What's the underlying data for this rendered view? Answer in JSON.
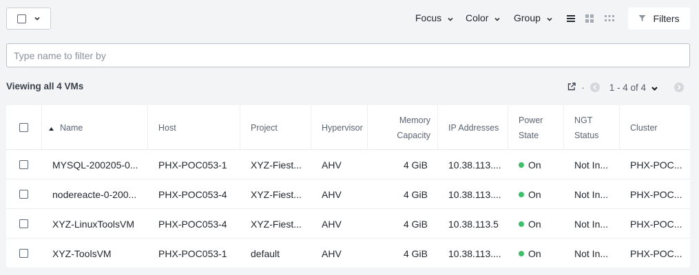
{
  "toolbar": {
    "menus": [
      {
        "label": "Focus",
        "icon": "chevron-down-icon"
      },
      {
        "label": "Color",
        "icon": "chevron-down-icon"
      },
      {
        "label": "Group",
        "icon": "chevron-down-icon"
      }
    ],
    "view_icons": [
      "list-view-icon",
      "grid-view-icon",
      "tile-view-icon"
    ],
    "filters_label": "Filters",
    "filters_icon": "funnel-icon"
  },
  "search": {
    "placeholder": "Type name to filter by",
    "value": ""
  },
  "summary": {
    "text": "Viewing all 4 VMs"
  },
  "pager": {
    "range_label": "1 - 4 of 4",
    "separator": "·"
  },
  "table": {
    "columns": [
      {
        "label": "Name",
        "sort": "ascending"
      },
      {
        "label": "Host"
      },
      {
        "label": "Project"
      },
      {
        "label": "Hypervisor"
      },
      {
        "label_line1": "Memory",
        "label_line2": "Capacity"
      },
      {
        "label": "IP Addresses"
      },
      {
        "label_line1": "Power",
        "label_line2": "State"
      },
      {
        "label_line1": "NGT",
        "label_line2": "Status"
      },
      {
        "label": "Cluster"
      }
    ],
    "rows": [
      {
        "name": "MYSQL-200205-0...",
        "host": "PHX-POC053-1",
        "project": "XYZ-Fiest...",
        "hypervisor": "AHV",
        "memory": "4 GiB",
        "ip": "10.38.113....",
        "power": "On",
        "ngt": "Not In...",
        "cluster": "PHX-POC..."
      },
      {
        "name": "nodereacte-0-200...",
        "host": "PHX-POC053-4",
        "project": "XYZ-Fiest...",
        "hypervisor": "AHV",
        "memory": "4 GiB",
        "ip": "10.38.113....",
        "power": "On",
        "ngt": "Not In...",
        "cluster": "PHX-POC..."
      },
      {
        "name": "XYZ-LinuxToolsVM",
        "host": "PHX-POC053-4",
        "project": "XYZ-Fiest...",
        "hypervisor": "AHV",
        "memory": "4 GiB",
        "ip": "10.38.113.5",
        "power": "On",
        "ngt": "Not In...",
        "cluster": "PHX-POC..."
      },
      {
        "name": "XYZ-ToolsVM",
        "host": "PHX-POC053-1",
        "project": "default",
        "hypervisor": "AHV",
        "memory": "4 GiB",
        "ip": "10.38.113....",
        "power": "On",
        "ngt": "Not In...",
        "cluster": "PHX-POC..."
      }
    ]
  },
  "colors": {
    "power_on": "#3fbf6b",
    "page_bg": "#f3f4f6"
  }
}
